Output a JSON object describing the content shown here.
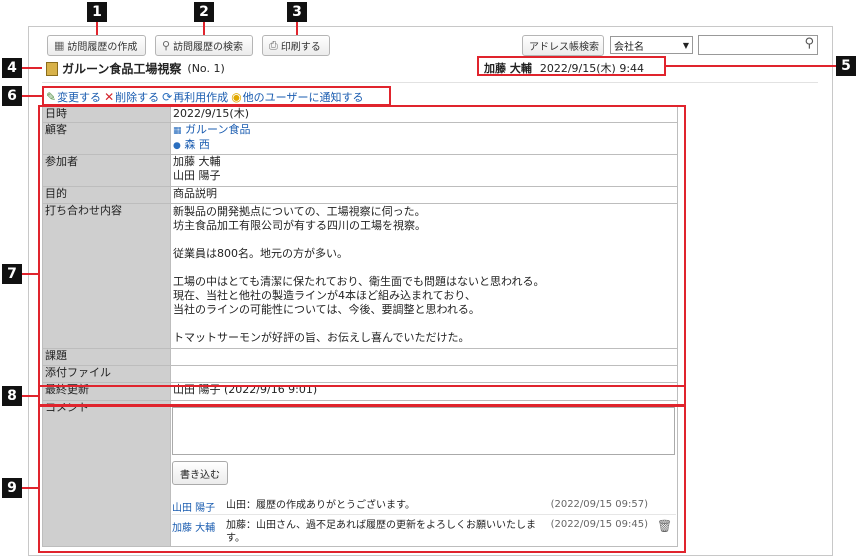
{
  "toolbar": {
    "create_label": "訪問履歴の作成",
    "search_label": "訪問履歴の検索",
    "print_label": "印刷する",
    "address_search_label": "アドレス帳検索",
    "company_select_value": "会社名",
    "search_placeholder": ""
  },
  "markers": [
    "1",
    "2",
    "3",
    "4",
    "5",
    "6",
    "7",
    "8",
    "9"
  ],
  "record": {
    "title": "ガルーン食品工場視察",
    "number": "(No. 1)",
    "author": "加藤 大輔",
    "datetime": "2022/9/15(木) 9:44"
  },
  "actions": {
    "edit": "変更する",
    "delete": "削除する",
    "reuse": "再利用作成",
    "notify": "他のユーザーに通知する"
  },
  "fields": {
    "date_label": "日時",
    "date_value": "2022/9/15(木)",
    "customer_label": "顧客",
    "customer_company": "ガルーン食品",
    "customer_person": "森 西",
    "participants_label": "参加者",
    "participant_1": "加藤 大輔",
    "participant_2": "山田 陽子",
    "purpose_label": "目的",
    "purpose_value": "商品説明",
    "meeting_label": "打ち合わせ内容",
    "meeting_lines": [
      "新製品の開発拠点についての、工場視察に伺った。",
      "坊主食品加工有限公司が有する四川の工場を視察。",
      "",
      "従業員は800名。地元の方が多い。",
      "",
      "工場の中はとても清潔に保たれており、衛生面でも問題はないと思われる。",
      "現在、当社と他社の製造ラインが4本ほど組み込まれており、",
      "当社のラインの可能性については、今後、要調整と思われる。",
      "",
      "トマットサーモンが好評の旨、お伝えし喜んでいただけた。"
    ],
    "issue_label": "課題",
    "issue_value": "",
    "attachment_label": "添付ファイル",
    "attachment_value": "",
    "updated_label": "最終更新",
    "updated_value": "山田 陽子 (2022/9/16 9:01)",
    "comment_label": "コメント"
  },
  "comments": {
    "write_label": "書き込む",
    "items": [
      {
        "user": "山田 陽子",
        "text": "山田：履歴の作成ありがとうございます。",
        "time": "(2022/09/15 09:57)"
      },
      {
        "user": "加藤 大輔",
        "text": "加藤：山田さん、過不足あれば履歴の更新をよろしくお願いいたします。",
        "time": "(2022/09/15 09:45)"
      }
    ]
  },
  "colors": {
    "accent_red": "#e0242d",
    "link_blue": "#1a5cb0",
    "header_gray": "#cfcfcf"
  }
}
